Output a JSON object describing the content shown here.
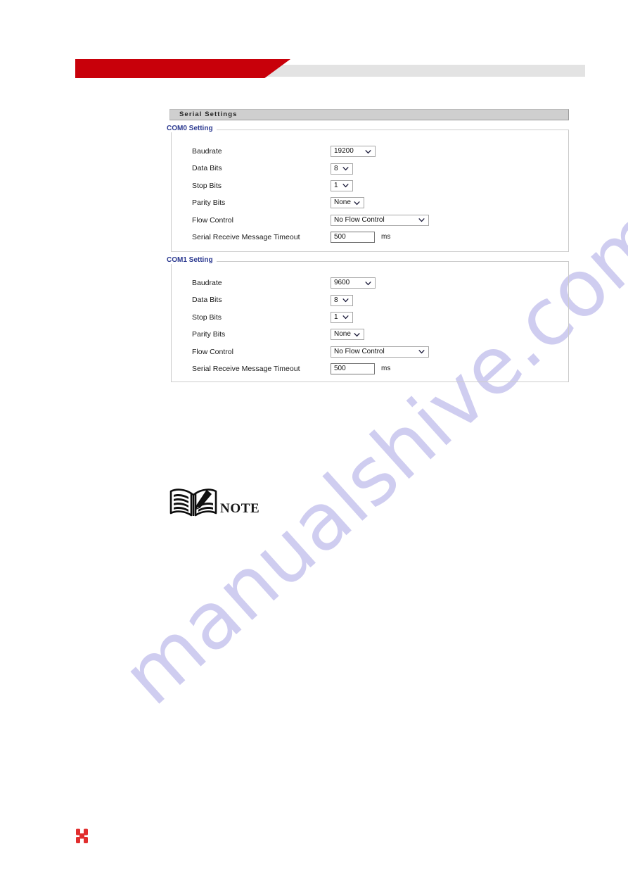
{
  "watermark": {
    "text": "manualshive.com",
    "color": "#ccc9ef"
  },
  "header": {
    "red_color": "#c8000a",
    "gray_color": "#e3e3e3"
  },
  "panel": {
    "title": "Serial Settings"
  },
  "sections": [
    {
      "legend": "COM0 Setting",
      "rows": [
        {
          "label": "Baudrate",
          "control": "select",
          "value": "19200",
          "unit": ""
        },
        {
          "label": "Data Bits",
          "control": "select",
          "value": "8",
          "unit": ""
        },
        {
          "label": "Stop Bits",
          "control": "select",
          "value": "1",
          "unit": ""
        },
        {
          "label": "Parity Bits",
          "control": "select",
          "value": "None",
          "unit": ""
        },
        {
          "label": "Flow Control",
          "control": "select",
          "value": "No Flow Control",
          "unit": ""
        },
        {
          "label": "Serial Receive Message Timeout",
          "control": "text",
          "value": "500",
          "unit": "ms"
        }
      ]
    },
    {
      "legend": "COM1 Setting",
      "rows": [
        {
          "label": "Baudrate",
          "control": "select",
          "value": "9600",
          "unit": ""
        },
        {
          "label": "Data Bits",
          "control": "select",
          "value": "8",
          "unit": ""
        },
        {
          "label": "Stop Bits",
          "control": "select",
          "value": "1",
          "unit": ""
        },
        {
          "label": "Parity Bits",
          "control": "select",
          "value": "None",
          "unit": ""
        },
        {
          "label": "Flow Control",
          "control": "select",
          "value": "No Flow Control",
          "unit": ""
        },
        {
          "label": "Serial Receive Message Timeout",
          "control": "text",
          "value": "500",
          "unit": "ms"
        }
      ]
    }
  ],
  "note": {
    "label": "NOTE",
    "icon": "open-book-with-pen-icon"
  },
  "footer": {
    "logo_icon": "h-mark-logo",
    "logo_color": "#e12d2d"
  }
}
